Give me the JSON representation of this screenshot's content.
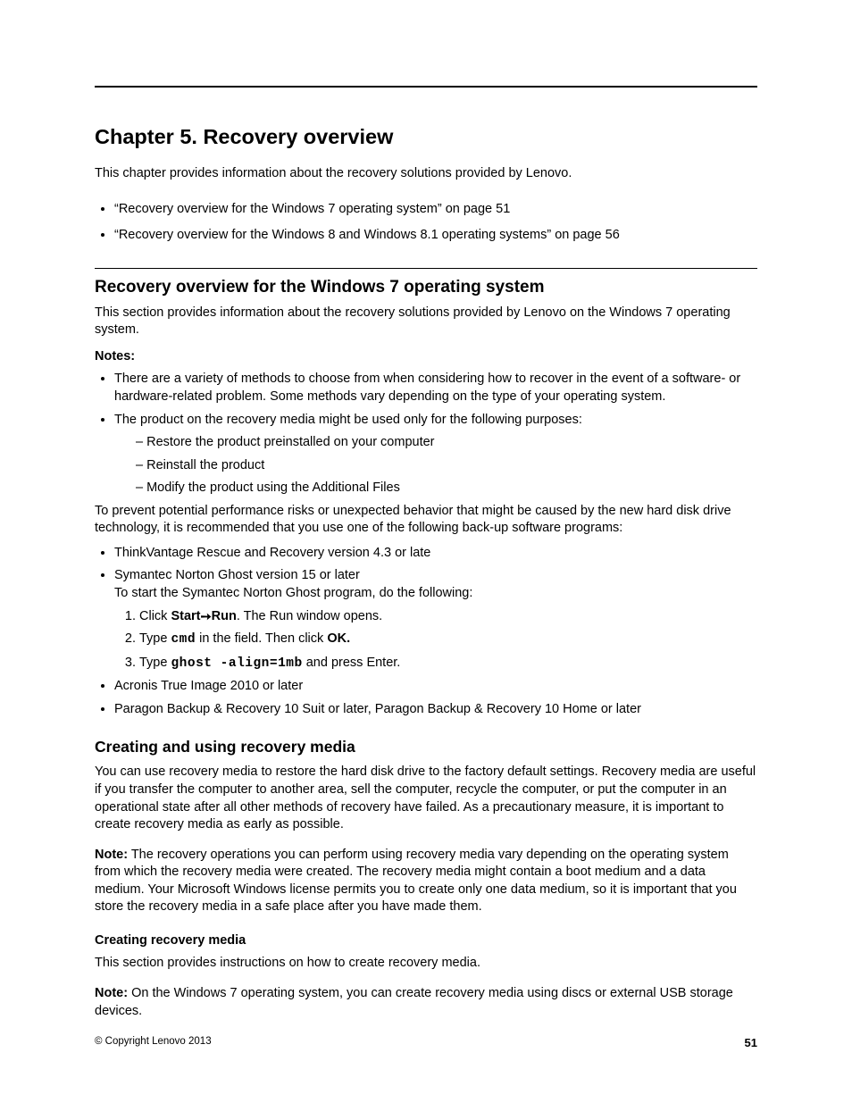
{
  "chapter": {
    "title": "Chapter 5.   Recovery overview",
    "intro": "This chapter provides information about the recovery solutions provided by Lenovo.",
    "toc": [
      "“Recovery overview for the Windows 7 operating system” on page 51",
      "“Recovery overview for the Windows 8 and Windows 8.1 operating systems” on page 56"
    ]
  },
  "section1": {
    "title": "Recovery overview for the Windows 7 operating system",
    "intro": "This section provides information about the recovery solutions provided by Lenovo on the Windows 7 operating system.",
    "notes_label": "Notes:",
    "notes": [
      "There are a variety of methods to choose from when considering how to recover in the event of a software- or hardware-related problem. Some methods vary depending on the type of your operating system.",
      "The product on the recovery media might be used only for the following purposes:"
    ],
    "note2_sub": [
      "Restore the product preinstalled on your computer",
      "Reinstall the product",
      "Modify the product using the Additional Files"
    ],
    "para_after_notes": "To prevent potential performance risks or unexpected behavior that might be caused by the new hard disk drive technology, it is recommended that you use one of the following back-up software programs:",
    "backup_list": {
      "item1": "ThinkVantage Rescue and Recovery version 4.3 or late",
      "item2_line1": "Symantec Norton Ghost version 15 or later",
      "item2_line2": "To start the Symantec Norton Ghost program, do the following:",
      "item2_steps": {
        "s1_a": "Click ",
        "s1_b_start": "Start",
        "s1_arrow": " ➙ ",
        "s1_b_run": "Run",
        "s1_c": ". The Run window opens.",
        "s2_a": "Type ",
        "s2_b_cmd": "cmd",
        "s2_c": " in the field.  Then click ",
        "s2_d_ok": "OK.",
        "s3_a": "Type ",
        "s3_b_cmd": "ghost -align=1mb",
        "s3_c": " and press Enter."
      },
      "item3": "Acronis True Image 2010 or later",
      "item4": "Paragon Backup & Recovery 10 Suit or later, Paragon Backup & Recovery 10 Home or later"
    }
  },
  "section2": {
    "title": "Creating and using recovery media",
    "p1": "You can use recovery media to restore the hard disk drive to the factory default settings. Recovery media are useful if you transfer the computer to another area, sell the computer, recycle the computer, or put the computer in an operational state after all other methods of recovery have failed. As a precautionary measure, it is important to create recovery media as early as possible.",
    "note_label": "Note:",
    "note_body": " The recovery operations you can perform using recovery media vary depending on the operating system from which the recovery media were created. The recovery media might contain a boot medium and a data medium. Your Microsoft Windows license permits you to create only one data medium, so it is important that you store the recovery media in a safe place after you have made them.",
    "sub_h": "Creating recovery media",
    "sub_p1": "This section provides instructions on how to create recovery media.",
    "sub_note_label": "Note:",
    "sub_note_body": " On the Windows 7 operating system, you can create recovery media using discs or external USB storage devices."
  },
  "footer": {
    "copyright": "© Copyright Lenovo 2013",
    "page": "51"
  }
}
